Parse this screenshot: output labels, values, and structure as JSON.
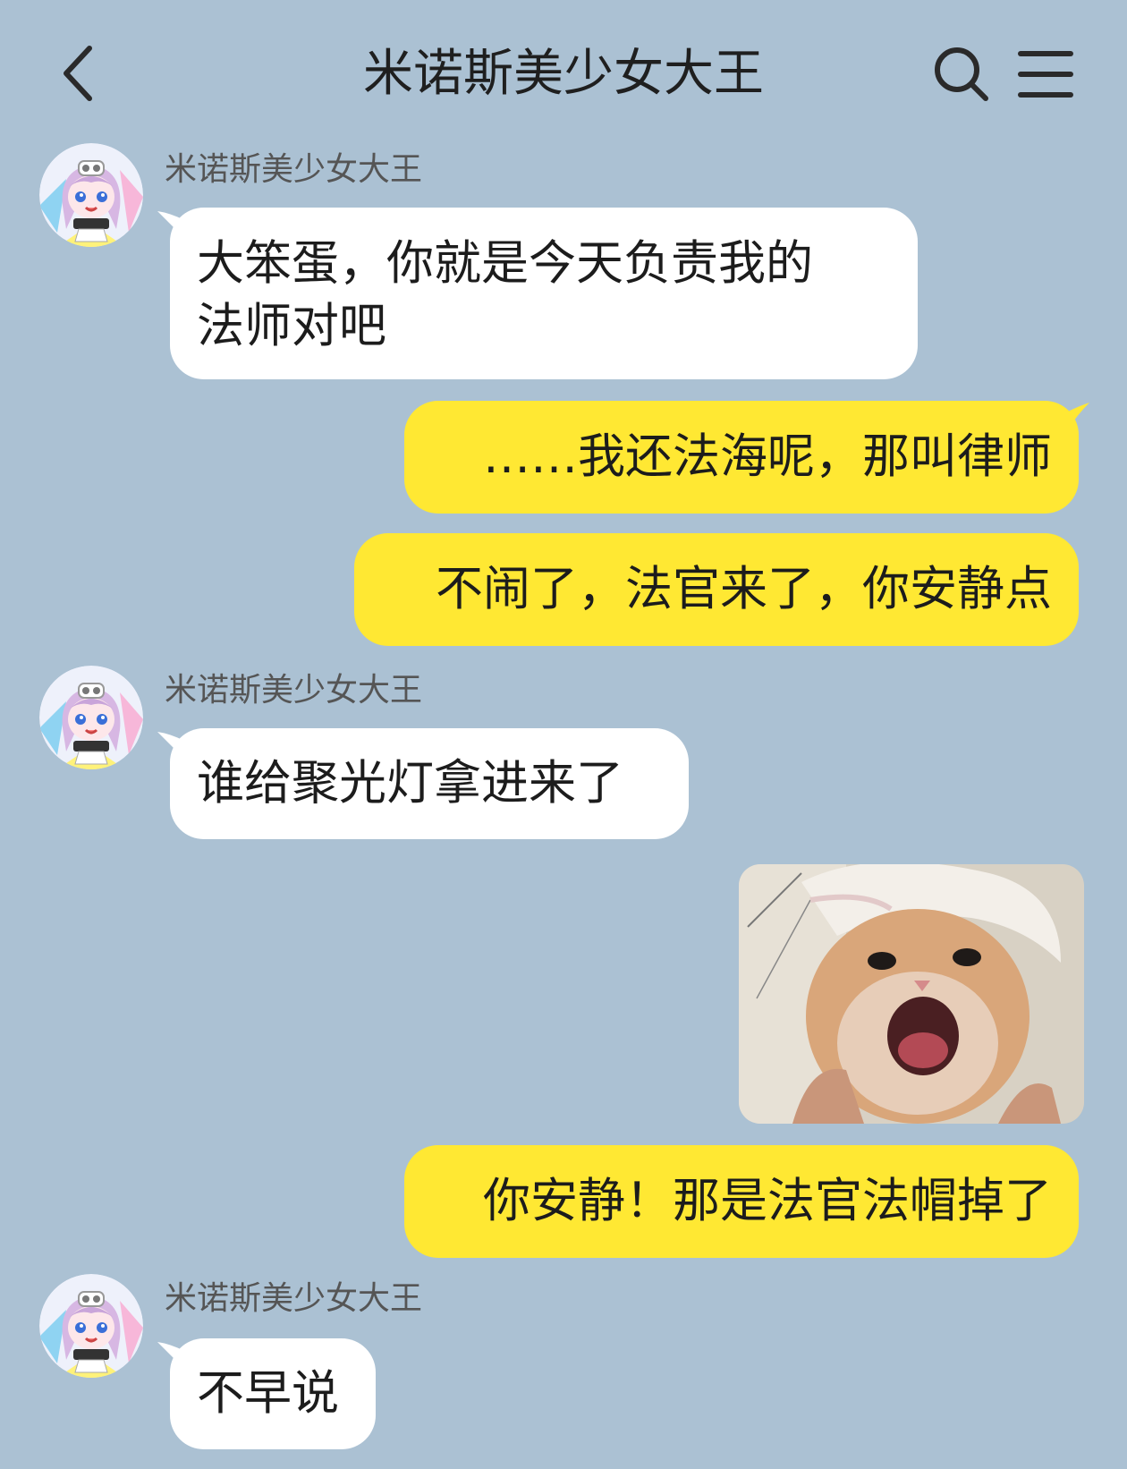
{
  "header": {
    "title": "米诺斯美少女大王"
  },
  "icons": {
    "back": "chevron-left-icon",
    "search": "search-icon",
    "menu": "hamburger-menu-icon"
  },
  "colors": {
    "background": "#abc1d3",
    "incoming_bubble": "#ffffff",
    "outgoing_bubble": "#ffe833"
  },
  "messages": [
    {
      "side": "incoming",
      "sender": "米诺斯美少女大王",
      "lines": [
        "大笨蛋，你就是今天负责我的",
        "法师对吧"
      ]
    },
    {
      "side": "outgoing",
      "text": "……我还法海呢，那叫律师"
    },
    {
      "side": "outgoing",
      "text": "不闹了，法官来了，你安静点"
    },
    {
      "side": "incoming",
      "sender": "米诺斯美少女大王",
      "text": "谁给聚光灯拿进来了"
    },
    {
      "side": "outgoing",
      "image": "screaming-kitten-meme"
    },
    {
      "side": "outgoing",
      "text": "你安静！那是法官法帽掉了"
    },
    {
      "side": "incoming",
      "sender": "米诺斯美少女大王",
      "text": "不早说"
    }
  ]
}
